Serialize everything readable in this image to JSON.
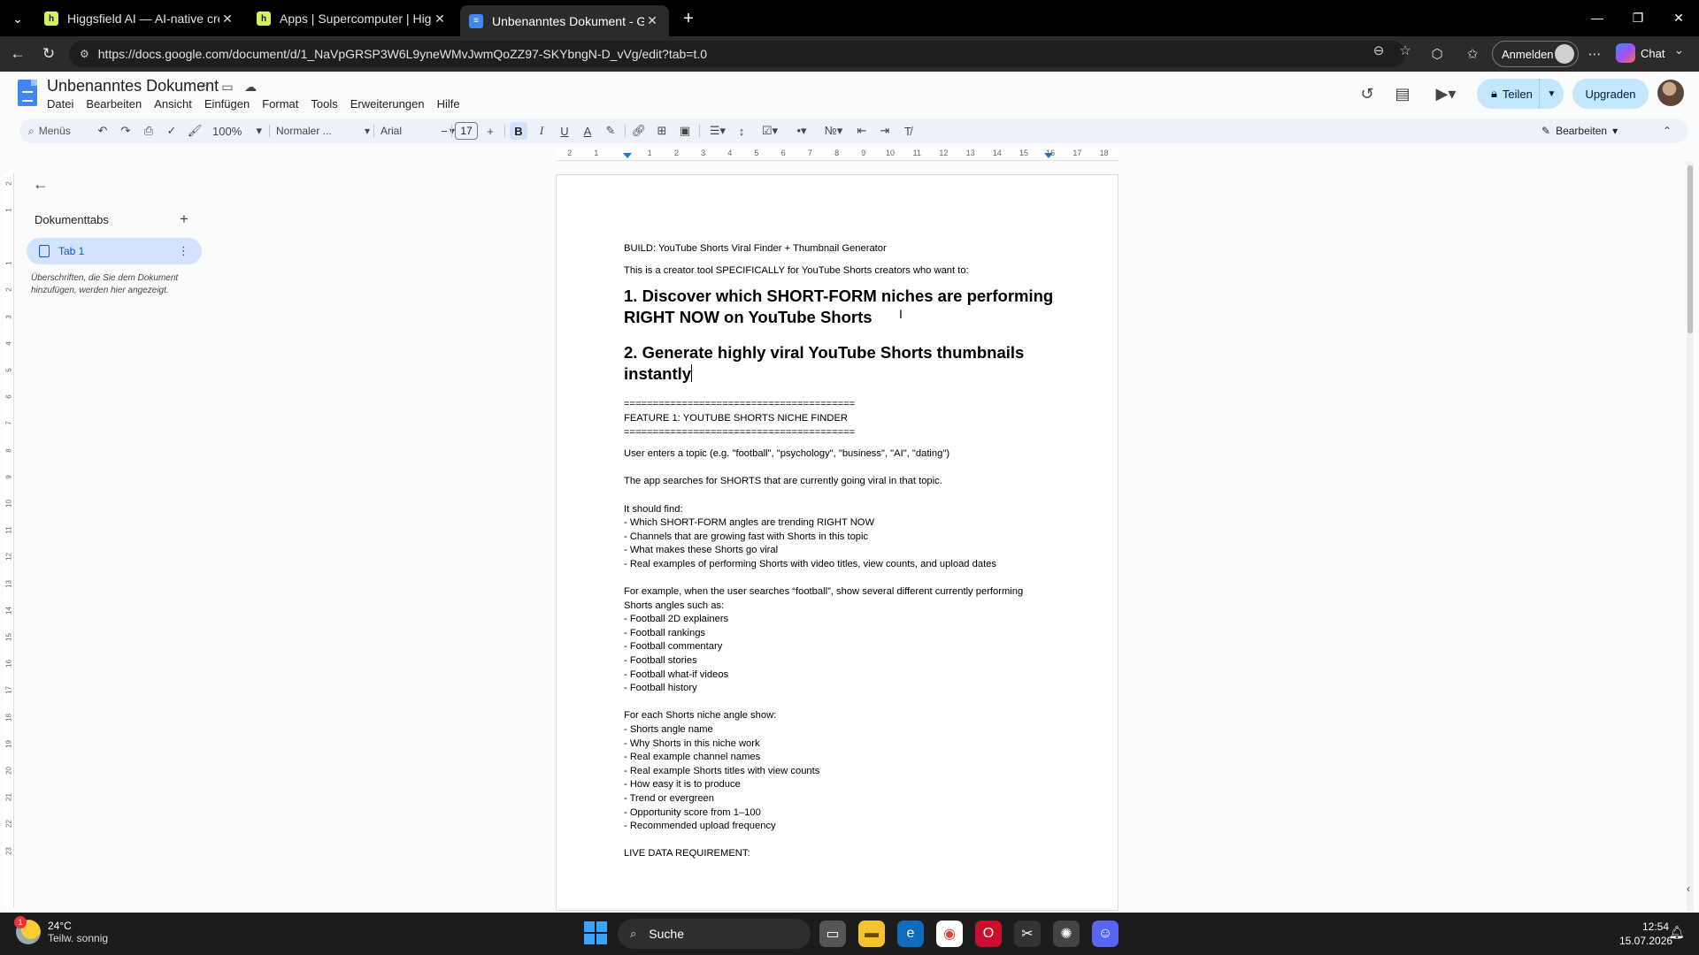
{
  "browser": {
    "tabs": [
      {
        "title": "Higgsfield AI — AI-native creative",
        "favicon": "higgsfield-icon"
      },
      {
        "title": "Apps | Supercomputer | Higgsfield",
        "favicon": "higgsfield-icon"
      },
      {
        "title": "Unbenanntes Dokument - Google",
        "favicon": "docs-icon",
        "active": true
      }
    ],
    "new_tab_symbol": "+",
    "url": "https://docs.google.com/document/d/1_NaVpGRSP3W6L9yneWMvJwmQoZZ97-SKYbngN-D_vVg/edit?tab=t.0",
    "signin_label": "Anmelden",
    "chat_label": "Chat"
  },
  "docs": {
    "title": "Unbenanntes Dokument",
    "menu": [
      "Datei",
      "Bearbeiten",
      "Ansicht",
      "Einfügen",
      "Format",
      "Tools",
      "Erweiterungen",
      "Hilfe"
    ],
    "share_label": "Teilen",
    "upgrade_label": "Upgraden",
    "accent": "#c2e7ff",
    "brand_blue": "#4285f4"
  },
  "toolbar": {
    "search_label": "Menüs",
    "zoom": "100%",
    "style": "Normaler ...",
    "font": "Arial",
    "font_size": "17",
    "mode_label": "Bearbeiten"
  },
  "ruler": {
    "marks": [
      "2",
      "1",
      "1",
      "2",
      "3",
      "4",
      "5",
      "6",
      "7",
      "8",
      "9",
      "10",
      "11",
      "12",
      "13",
      "14",
      "15",
      "16",
      "17",
      "18"
    ],
    "vmarks": [
      "2",
      "1",
      "1",
      "2",
      "3",
      "4",
      "5",
      "6",
      "7",
      "8",
      "9",
      "10",
      "11",
      "12",
      "13",
      "14",
      "15",
      "16",
      "17",
      "18",
      "19",
      "20",
      "21",
      "22",
      "23"
    ]
  },
  "outline": {
    "heading": "Dokumenttabs",
    "tab_label": "Tab 1",
    "hint": "Überschriften, die Sie dem Dokument hinzufügen, werden hier angezeigt."
  },
  "document": {
    "lines": [
      {
        "t": "p",
        "text": "BUILD: YouTube Shorts Viral Finder + Thumbnail Generator"
      },
      {
        "t": "gapm"
      },
      {
        "t": "p",
        "text": "This is a creator tool SPECIFICALLY for YouTube Shorts creators who want to:"
      },
      {
        "t": "gapm"
      },
      {
        "t": "h",
        "text": "1. Discover which SHORT-FORM niches are performing RIGHT NOW on YouTube Shorts"
      },
      {
        "t": "gap"
      },
      {
        "t": "h",
        "text": "2. Generate highly viral YouTube Shorts thumbnails instantly",
        "caret": true
      },
      {
        "t": "gap"
      },
      {
        "t": "p",
        "text": "========================================"
      },
      {
        "t": "p",
        "text": "FEATURE 1: YOUTUBE SHORTS NICHE FINDER"
      },
      {
        "t": "p",
        "text": "========================================"
      },
      {
        "t": "gapm"
      },
      {
        "t": "p",
        "text": "User enters a topic (e.g. \"football\", \"psychology\", \"business\", \"AI\", \"dating\")"
      },
      {
        "t": "gap"
      },
      {
        "t": "p",
        "text": "The app searches for SHORTS that are currently going viral in that topic."
      },
      {
        "t": "gap"
      },
      {
        "t": "p",
        "text": "It should find:"
      },
      {
        "t": "p",
        "text": "- Which SHORT-FORM angles are trending RIGHT NOW"
      },
      {
        "t": "p",
        "text": "- Channels that are growing fast with Shorts in this topic"
      },
      {
        "t": "p",
        "text": "- What makes these Shorts go viral"
      },
      {
        "t": "p",
        "text": "- Real examples of performing Shorts with video titles, view counts, and upload dates"
      },
      {
        "t": "gap"
      },
      {
        "t": "p",
        "text": "For example, when the user searches “football”, show several different currently performing"
      },
      {
        "t": "p",
        "text": "Shorts angles such as:"
      },
      {
        "t": "p",
        "text": "- Football 2D explainers"
      },
      {
        "t": "p",
        "text": "- Football rankings"
      },
      {
        "t": "p",
        "text": "- Football commentary"
      },
      {
        "t": "p",
        "text": "- Football stories"
      },
      {
        "t": "p",
        "text": "- Football what-if videos"
      },
      {
        "t": "p",
        "text": "- Football history"
      },
      {
        "t": "gap"
      },
      {
        "t": "p",
        "text": "For each Shorts niche angle show:"
      },
      {
        "t": "p",
        "text": "- Shorts angle name"
      },
      {
        "t": "p",
        "text": "- Why Shorts in this niche work"
      },
      {
        "t": "p",
        "text": "- Real example channel names"
      },
      {
        "t": "p",
        "text": "- Real example Shorts titles with view counts"
      },
      {
        "t": "p",
        "text": "- How easy it is to produce"
      },
      {
        "t": "p",
        "text": "- Trend or evergreen"
      },
      {
        "t": "p",
        "text": "- Opportunity score from 1–100"
      },
      {
        "t": "p",
        "text": "- Recommended upload frequency"
      },
      {
        "t": "gap"
      },
      {
        "t": "p",
        "text": "LIVE DATA REQUIREMENT:"
      }
    ]
  },
  "taskbar": {
    "temperature": "24°C",
    "weather": "Teilw. sonnig",
    "weather_badge": "1",
    "search_label": "Suche",
    "time": "12:54",
    "date": "15.07.2026"
  }
}
